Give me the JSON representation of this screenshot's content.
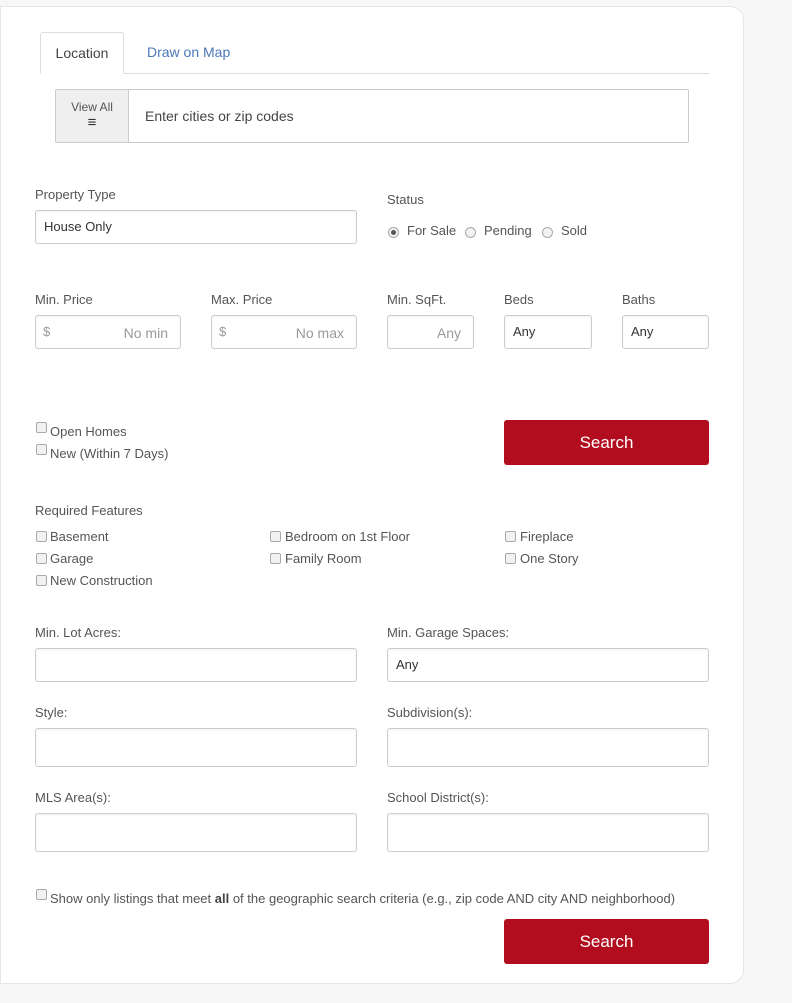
{
  "tabs": {
    "location": "Location",
    "draw_on_map": "Draw on Map"
  },
  "location": {
    "view_all": "View All",
    "view_all_icon": "list-icon",
    "placeholder": "Enter cities or zip codes"
  },
  "property_type": {
    "label": "Property Type",
    "value": "House Only"
  },
  "status": {
    "label": "Status",
    "options": [
      "For Sale",
      "Pending",
      "Sold"
    ],
    "selected": "For Sale"
  },
  "price": {
    "min_label": "Min. Price",
    "max_label": "Max. Price",
    "currency": "$",
    "min_placeholder": "No min",
    "max_placeholder": "No max"
  },
  "sqft": {
    "label": "Min. SqFt.",
    "placeholder": "Any"
  },
  "beds": {
    "label": "Beds",
    "value": "Any"
  },
  "baths": {
    "label": "Baths",
    "value": "Any"
  },
  "quick_filters": [
    "Open Homes",
    "New (Within 7 Days)"
  ],
  "search_label": "Search",
  "features": {
    "label": "Required Features",
    "items": [
      "Basement",
      "Garage",
      "New Construction",
      "Bedroom on 1st Floor",
      "Family Room",
      "Fireplace",
      "One Story"
    ]
  },
  "lot": {
    "label": "Min. Lot Acres:",
    "value": ""
  },
  "garage": {
    "label": "Min. Garage Spaces:",
    "value": "Any"
  },
  "style": {
    "label": "Style:",
    "value": ""
  },
  "subdivision": {
    "label": "Subdivision(s):",
    "value": ""
  },
  "mls": {
    "label": "MLS Area(s):",
    "value": ""
  },
  "school": {
    "label": "School District(s):",
    "value": ""
  },
  "geo": {
    "pre": "Show only listings that meet ",
    "bold": "all",
    "post": " of the geographic search criteria (e.g., zip code AND city AND neighborhood)"
  },
  "colors": {
    "accent": "#b20d1e",
    "link": "#4a78b9"
  }
}
